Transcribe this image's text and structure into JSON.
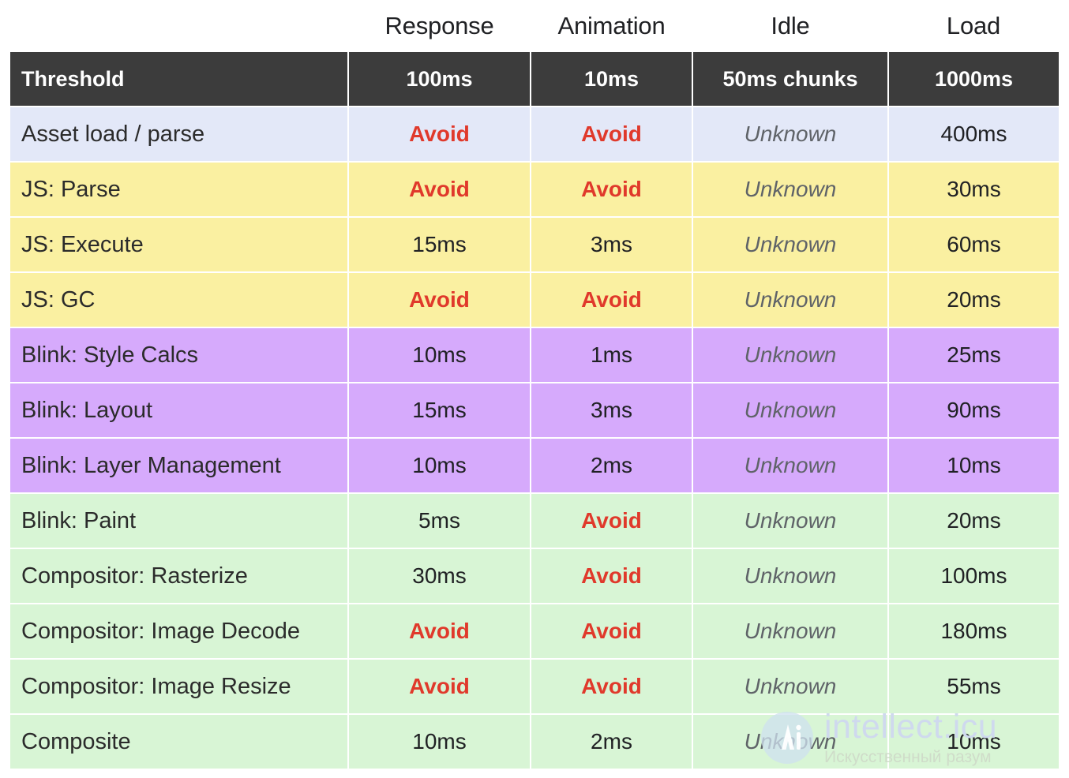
{
  "column_headers": {
    "label_spacer": "",
    "items": [
      {
        "name": "response",
        "label": "Response"
      },
      {
        "name": "animation",
        "label": "Animation"
      },
      {
        "name": "idle",
        "label": "Idle"
      },
      {
        "name": "load",
        "label": "Load"
      }
    ]
  },
  "threshold_row": {
    "label": "Threshold",
    "response": "100ms",
    "animation": "10ms",
    "idle": "50ms chunks",
    "load": "1000ms"
  },
  "colors": {
    "header_bg": "#3c3c3c",
    "header_text": "#ffffff",
    "group_asset": "#e3e8f8",
    "group_js": "#faf0a1",
    "group_blink": "#d6aafc",
    "group_compositor": "#d8f5d5",
    "avoid_text": "#e0392b",
    "unknown_text": "#5f6368",
    "value_text": "#202124",
    "grid_line": "#ffffff"
  },
  "rows": [
    {
      "group": "asset",
      "label": "Asset load / parse",
      "cells": [
        {
          "text": "Avoid",
          "kind": "avoid"
        },
        {
          "text": "Avoid",
          "kind": "avoid"
        },
        {
          "text": "Unknown",
          "kind": "unknown"
        },
        {
          "text": "400ms",
          "kind": "num"
        }
      ]
    },
    {
      "group": "js",
      "label": "JS: Parse",
      "cells": [
        {
          "text": "Avoid",
          "kind": "avoid"
        },
        {
          "text": "Avoid",
          "kind": "avoid"
        },
        {
          "text": "Unknown",
          "kind": "unknown"
        },
        {
          "text": "30ms",
          "kind": "num"
        }
      ]
    },
    {
      "group": "js",
      "label": "JS: Execute",
      "cells": [
        {
          "text": "15ms",
          "kind": "num"
        },
        {
          "text": "3ms",
          "kind": "num"
        },
        {
          "text": "Unknown",
          "kind": "unknown"
        },
        {
          "text": "60ms",
          "kind": "num"
        }
      ]
    },
    {
      "group": "js",
      "label": "JS: GC",
      "cells": [
        {
          "text": "Avoid",
          "kind": "avoid"
        },
        {
          "text": "Avoid",
          "kind": "avoid"
        },
        {
          "text": "Unknown",
          "kind": "unknown"
        },
        {
          "text": "20ms",
          "kind": "num"
        }
      ]
    },
    {
      "group": "blink",
      "label": "Blink: Style Calcs",
      "cells": [
        {
          "text": "10ms",
          "kind": "num"
        },
        {
          "text": "1ms",
          "kind": "num"
        },
        {
          "text": "Unknown",
          "kind": "unknown"
        },
        {
          "text": "25ms",
          "kind": "num"
        }
      ]
    },
    {
      "group": "blink",
      "label": "Blink: Layout",
      "cells": [
        {
          "text": "15ms",
          "kind": "num"
        },
        {
          "text": "3ms",
          "kind": "num"
        },
        {
          "text": "Unknown",
          "kind": "unknown"
        },
        {
          "text": "90ms",
          "kind": "num"
        }
      ]
    },
    {
      "group": "blink",
      "label": "Blink: Layer Management",
      "cells": [
        {
          "text": "10ms",
          "kind": "num"
        },
        {
          "text": "2ms",
          "kind": "num"
        },
        {
          "text": "Unknown",
          "kind": "unknown"
        },
        {
          "text": "10ms",
          "kind": "num"
        }
      ]
    },
    {
      "group": "comp",
      "label": "Blink: Paint",
      "cells": [
        {
          "text": "5ms",
          "kind": "num"
        },
        {
          "text": "Avoid",
          "kind": "avoid"
        },
        {
          "text": "Unknown",
          "kind": "unknown"
        },
        {
          "text": "20ms",
          "kind": "num"
        }
      ]
    },
    {
      "group": "comp",
      "label": "Compositor: Rasterize",
      "cells": [
        {
          "text": "30ms",
          "kind": "num"
        },
        {
          "text": "Avoid",
          "kind": "avoid"
        },
        {
          "text": "Unknown",
          "kind": "unknown"
        },
        {
          "text": "100ms",
          "kind": "num"
        }
      ]
    },
    {
      "group": "comp",
      "label": "Compositor: Image Decode",
      "cells": [
        {
          "text": "Avoid",
          "kind": "avoid"
        },
        {
          "text": "Avoid",
          "kind": "avoid"
        },
        {
          "text": "Unknown",
          "kind": "unknown"
        },
        {
          "text": "180ms",
          "kind": "num"
        }
      ]
    },
    {
      "group": "comp",
      "label": "Compositor: Image Resize",
      "cells": [
        {
          "text": "Avoid",
          "kind": "avoid"
        },
        {
          "text": "Avoid",
          "kind": "avoid"
        },
        {
          "text": "Unknown",
          "kind": "unknown"
        },
        {
          "text": "55ms",
          "kind": "num"
        }
      ]
    },
    {
      "group": "comp",
      "label": "Composite",
      "cells": [
        {
          "text": "10ms",
          "kind": "num"
        },
        {
          "text": "2ms",
          "kind": "num"
        },
        {
          "text": "Unknown",
          "kind": "unknown"
        },
        {
          "text": "10ms",
          "kind": "num"
        }
      ]
    }
  ],
  "watermark": {
    "logo_icon": "ai-circle-logo-icon",
    "title": "intellect.icu",
    "subtitle": "Искусственный разум"
  },
  "chart_data": {
    "type": "table",
    "title": "",
    "columns": [
      "Threshold",
      "Response",
      "Animation",
      "Idle",
      "Load"
    ],
    "header_values": [
      "Threshold",
      "100ms",
      "10ms",
      "50ms chunks",
      "1000ms"
    ],
    "categories": [
      "Asset load / parse",
      "JS: Parse",
      "JS: Execute",
      "JS: GC",
      "Blink: Style Calcs",
      "Blink: Layout",
      "Blink: Layer Management",
      "Blink: Paint",
      "Compositor: Rasterize",
      "Compositor: Image Decode",
      "Compositor: Image Resize",
      "Composite"
    ],
    "series": [
      {
        "name": "Response",
        "values": [
          "Avoid",
          "Avoid",
          "15ms",
          "Avoid",
          "10ms",
          "15ms",
          "10ms",
          "5ms",
          "30ms",
          "Avoid",
          "Avoid",
          "10ms"
        ]
      },
      {
        "name": "Animation",
        "values": [
          "Avoid",
          "Avoid",
          "3ms",
          "Avoid",
          "1ms",
          "3ms",
          "2ms",
          "Avoid",
          "Avoid",
          "Avoid",
          "Avoid",
          "2ms"
        ]
      },
      {
        "name": "Idle",
        "values": [
          "Unknown",
          "Unknown",
          "Unknown",
          "Unknown",
          "Unknown",
          "Unknown",
          "Unknown",
          "Unknown",
          "Unknown",
          "Unknown",
          "Unknown",
          "Unknown"
        ]
      },
      {
        "name": "Load",
        "values": [
          "400ms",
          "30ms",
          "60ms",
          "20ms",
          "25ms",
          "90ms",
          "10ms",
          "20ms",
          "100ms",
          "180ms",
          "55ms",
          "10ms"
        ]
      }
    ],
    "row_groups": {
      "asset": [
        "Asset load / parse"
      ],
      "js": [
        "JS: Parse",
        "JS: Execute",
        "JS: GC"
      ],
      "blink": [
        "Blink: Style Calcs",
        "Blink: Layout",
        "Blink: Layer Management"
      ],
      "compositor": [
        "Blink: Paint",
        "Compositor: Rasterize",
        "Compositor: Image Decode",
        "Compositor: Image Resize",
        "Composite"
      ]
    },
    "grid": true,
    "legend": "none"
  }
}
